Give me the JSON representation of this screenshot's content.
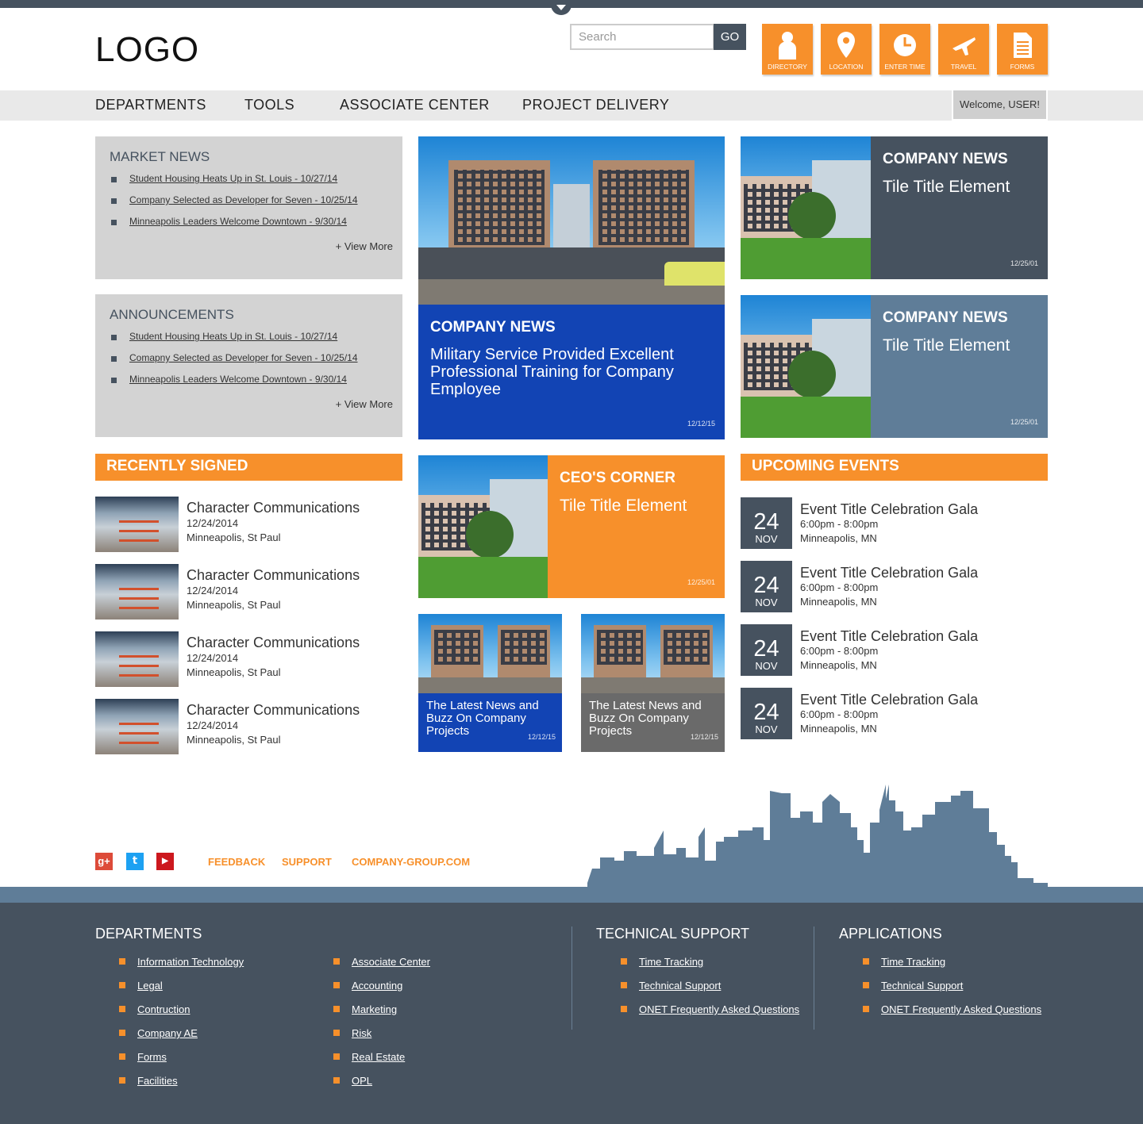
{
  "header": {
    "logo": "LOGO",
    "search_placeholder": "Search",
    "go_label": "GO",
    "quick_links": [
      {
        "label": "DIRECTORY",
        "icon": "person-icon"
      },
      {
        "label": "LOCATION",
        "icon": "map-pin-icon"
      },
      {
        "label": "ENTER TIME",
        "icon": "clock-icon"
      },
      {
        "label": "TRAVEL",
        "icon": "airplane-icon"
      },
      {
        "label": "FORMS",
        "icon": "document-icon"
      }
    ]
  },
  "nav": {
    "items": [
      "DEPARTMENTS",
      "TOOLS",
      "ASSOCIATE CENTER",
      "PROJECT DELIVERY"
    ],
    "welcome": "Welcome, USER!"
  },
  "market_news": {
    "title": "MARKET NEWS",
    "items": [
      "Student Housing Heats Up in St. Louis - 10/27/14",
      "Company Selected as Developer for Seven - 10/25/14",
      "Minneapolis Leaders Welcome Downtown - 9/30/14"
    ],
    "more": "+  View More"
  },
  "announcements": {
    "title": "ANNOUNCEMENTS",
    "items": [
      "Student Housing Heats Up in St. Louis - 10/27/14",
      "Comapny Selected as Developer for Seven - 10/25/14",
      "Minneapolis Leaders Welcome Downtown - 9/30/14"
    ],
    "more": "+  View More"
  },
  "recently_signed": {
    "title": "RECENTLY SIGNED",
    "items": [
      {
        "title": "Character Communications",
        "date": "12/24/2014",
        "place": "Minneapolis, St Paul"
      },
      {
        "title": "Character Communications",
        "date": "12/24/2014",
        "place": "Minneapolis, St Paul"
      },
      {
        "title": "Character Communications",
        "date": "12/24/2014",
        "place": "Minneapolis, St Paul"
      },
      {
        "title": "Character Communications",
        "date": "12/24/2014",
        "place": "Minneapolis, St Paul"
      }
    ]
  },
  "feature_tile": {
    "category": "COMPANY NEWS",
    "title": "Military Service Provided Excellent Professional Training for Company Employee",
    "date": "12/12/15",
    "color": "#1244b4"
  },
  "side_tiles": [
    {
      "category": "COMPANY NEWS",
      "title": "Tile Title Element",
      "date": "12/25/01",
      "color": "#46525f"
    },
    {
      "category": "COMPANY NEWS",
      "title": "Tile Title Element",
      "date": "12/25/01",
      "color": "#5f7d98"
    }
  ],
  "ceo_tile": {
    "category": "CEO'S CORNER",
    "title": "Tile Title Element",
    "date": "12/25/01",
    "color": "#f7902b"
  },
  "small_tiles": [
    {
      "title": "The Latest News and Buzz On Company Projects",
      "date": "12/12/15",
      "color": "#1244b4"
    },
    {
      "title": "The Latest News and Buzz On Company Projects",
      "date": "12/12/15",
      "color": "#6a6a6a"
    }
  ],
  "upcoming_events": {
    "title": "UPCOMING EVENTS",
    "items": [
      {
        "day": "24",
        "month": "NOV",
        "title": "Event Title Celebration Gala",
        "time": "6:00pm - 8:00pm",
        "place": "Minneapolis, MN"
      },
      {
        "day": "24",
        "month": "NOV",
        "title": "Event Title Celebration Gala",
        "time": "6:00pm - 8:00pm",
        "place": "Minneapolis, MN"
      },
      {
        "day": "24",
        "month": "NOV",
        "title": "Event Title Celebration Gala",
        "time": "6:00pm - 8:00pm",
        "place": "Minneapolis, MN"
      },
      {
        "day": "24",
        "month": "NOV",
        "title": "Event Title Celebration Gala",
        "time": "6:00pm - 8:00pm",
        "place": "Minneapolis, MN"
      }
    ]
  },
  "social": [
    {
      "name": "google-plus-icon",
      "glyph": "g+",
      "color": "#dd4b39"
    },
    {
      "name": "twitter-icon",
      "glyph": "t",
      "color": "#1da1f2"
    },
    {
      "name": "youtube-icon",
      "glyph": "▶",
      "color": "#cc181e"
    }
  ],
  "footer_links": [
    "FEEDBACK",
    "SUPPORT",
    "COMPANY-GROUP.COM"
  ],
  "footer": {
    "departments": {
      "title": "DEPARTMENTS",
      "col1": [
        "Information Technology",
        "Legal",
        "Contruction",
        "Company AE",
        "Forms",
        "Facilities"
      ],
      "col2": [
        "Associate Center",
        "Accounting",
        "Marketing",
        "Risk",
        "Real Estate",
        "OPL"
      ]
    },
    "technical_support": {
      "title": "TECHNICAL SUPPORT",
      "items": [
        "Time Tracking",
        "Technical Support",
        "ONET Frequently Asked Questions"
      ]
    },
    "applications": {
      "title": "APPLICATIONS",
      "items": [
        "Time Tracking",
        "Technical Support",
        "ONET Frequently Asked Questions"
      ]
    }
  },
  "colors": {
    "accent": "#f7902b",
    "slate": "#46525f",
    "steel": "#5f7d98",
    "blue": "#1244b4"
  }
}
